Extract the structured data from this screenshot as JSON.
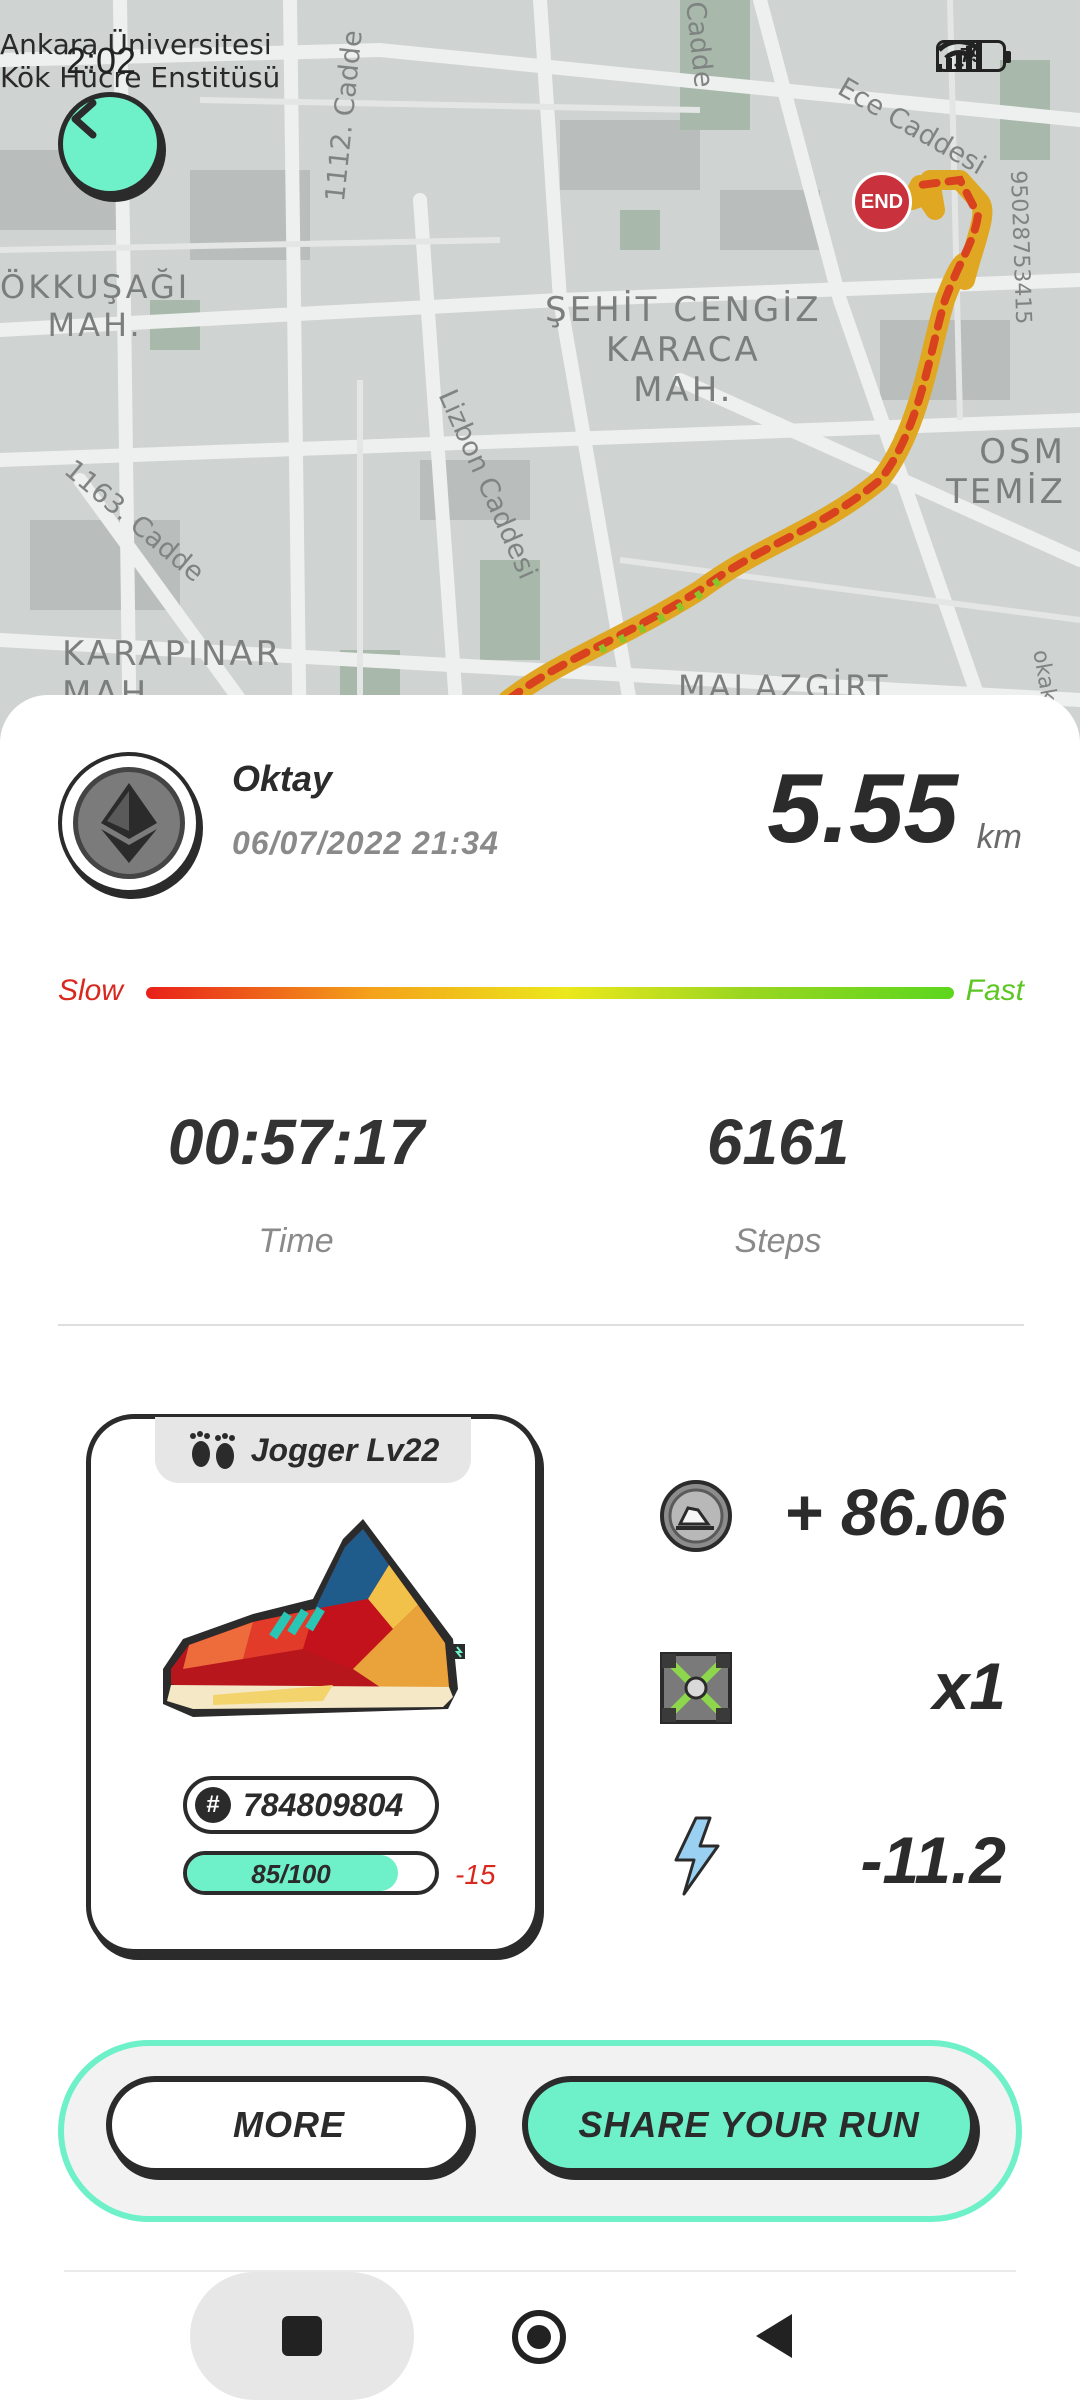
{
  "status_bar": {
    "time": "2:02",
    "battery": "79"
  },
  "map": {
    "labels": {
      "university": "Ankara Üniversitesi\nKök Hücre Enstitüsü",
      "gokkusagi": "ÖKKUŞAĞI\nMAH.",
      "sehit": "ŞEHİT CENGİZ\nKARACA\nMAH.",
      "osm": "OSM\nTEMİZ",
      "karapinar": "KARAPINAR\nMAH.",
      "malazgirt": "MALAZGİRT"
    },
    "streets": {
      "s1112": "1112. Cadde",
      "s1163": "1163. Cadde",
      "lizbon": "Lizbon Caddesi",
      "ece": "Ece Caddesi",
      "cadde_top": "Cadde",
      "number": "95028753415",
      "edge": "okak"
    },
    "end_marker": "END"
  },
  "run": {
    "user_name": "Oktay",
    "datetime": "06/07/2022 21:34",
    "distance": "5.55",
    "distance_unit": "km",
    "speed_slow": "Slow",
    "speed_fast": "Fast",
    "time_value": "00:57:17",
    "time_label": "Time",
    "steps_value": "6161",
    "steps_label": "Steps"
  },
  "sneaker": {
    "level": "Jogger Lv22",
    "id": "784809804",
    "durability_text": "85/100",
    "durability_fraction": 0.85,
    "durability_delta": "-15"
  },
  "rewards": {
    "coins": "+ 86.06",
    "box": "x1",
    "energy": "-11.2"
  },
  "actions": {
    "more": "MORE",
    "share": "SHARE YOUR RUN"
  },
  "colors": {
    "accent": "#6ef0c8",
    "dark": "#2b2b2b",
    "slow": "#d9281e",
    "fast": "#5cc623"
  }
}
